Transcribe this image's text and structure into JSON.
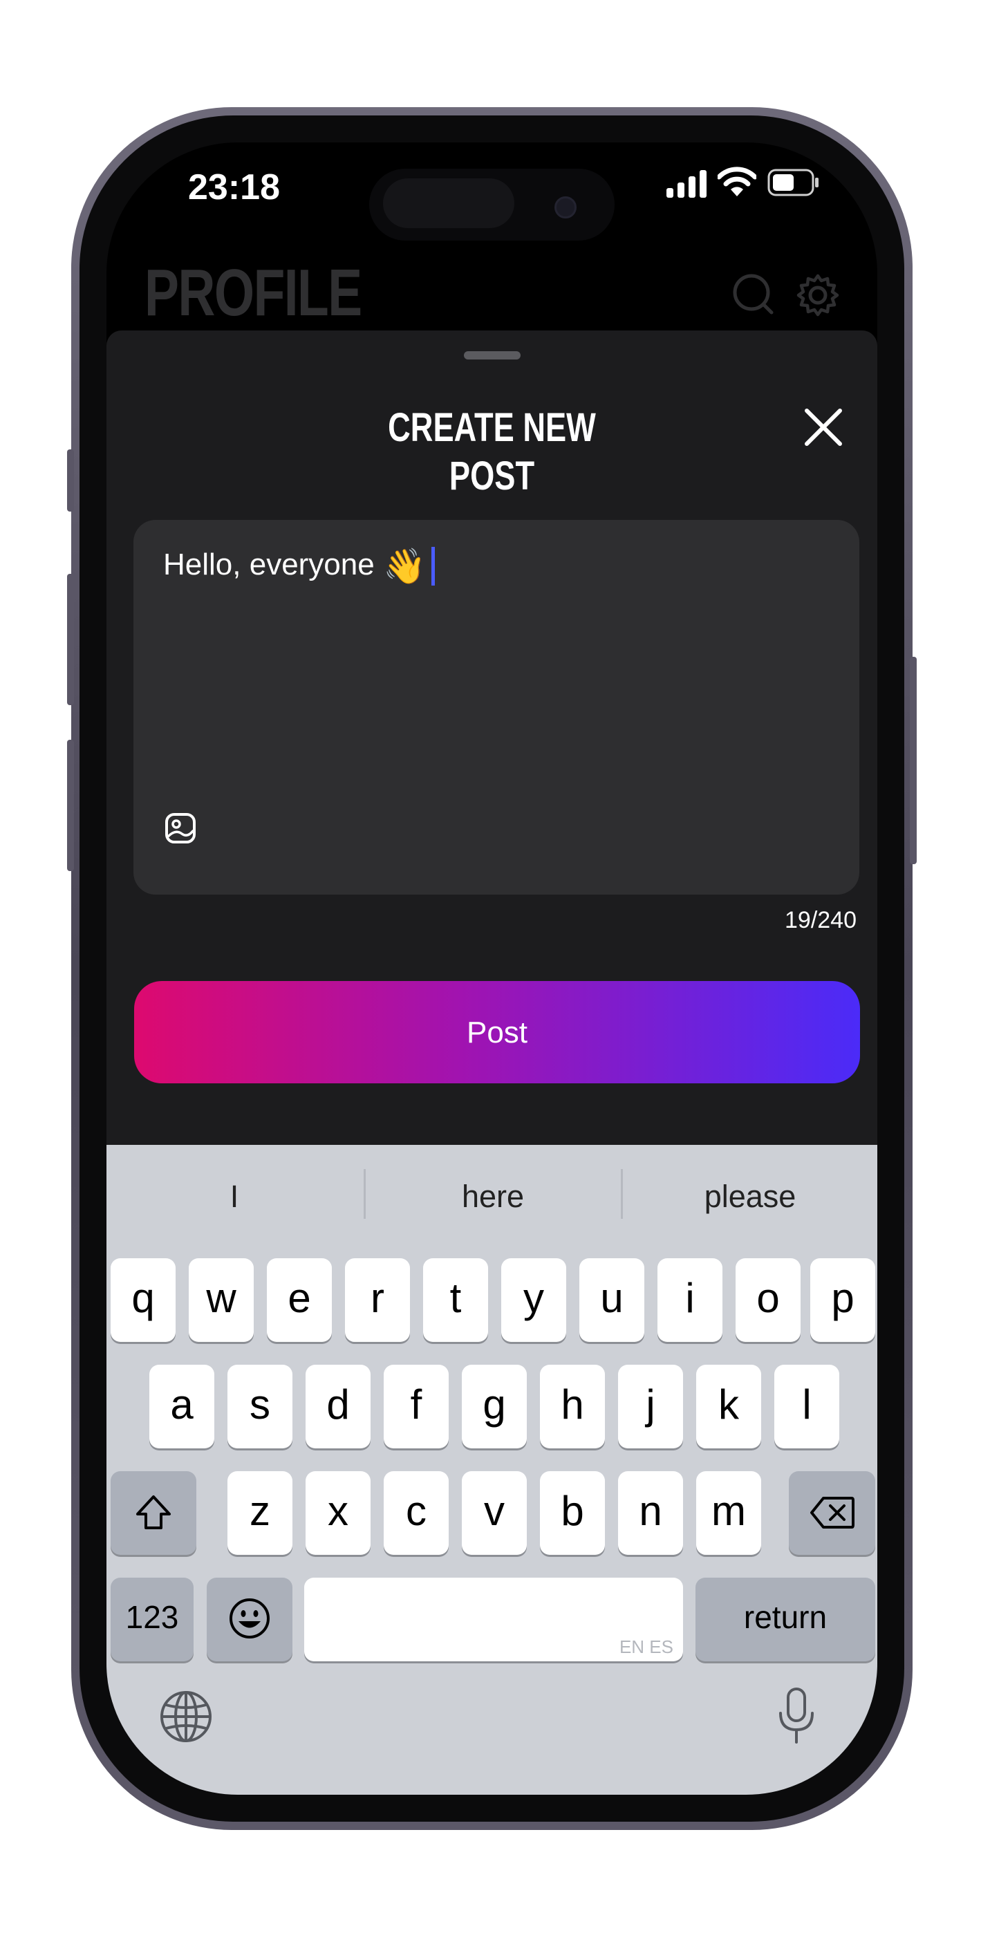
{
  "status_bar": {
    "time": "23:18"
  },
  "background_screen": {
    "title": "PROFILE"
  },
  "sheet": {
    "title": "CREATE NEW POST",
    "post_text": "Hello, everyone",
    "post_emoji": "👋",
    "counter": "19/240",
    "post_button": "Post"
  },
  "keyboard": {
    "suggestions": [
      "I",
      "here",
      "please"
    ],
    "row1": [
      "q",
      "w",
      "e",
      "r",
      "t",
      "y",
      "u",
      "i",
      "o",
      "p"
    ],
    "row2": [
      "a",
      "s",
      "d",
      "f",
      "g",
      "h",
      "j",
      "k",
      "l"
    ],
    "row3": [
      "z",
      "x",
      "c",
      "v",
      "b",
      "n",
      "m"
    ],
    "numbers_key": "123",
    "space_languages": "EN ES",
    "return_key": "return"
  },
  "icons": [
    "search-icon",
    "settings-icon",
    "close-icon",
    "image-icon",
    "shift-icon",
    "delete-icon",
    "emoji-icon",
    "globe-icon",
    "microphone-icon"
  ],
  "colors": {
    "gradient_start": "#dd0a6f",
    "gradient_end": "#4b2bf8",
    "caret": "#4a5cff",
    "sheet_bg": "#1c1c1e",
    "keyboard_bg": "#cdd0d6"
  }
}
